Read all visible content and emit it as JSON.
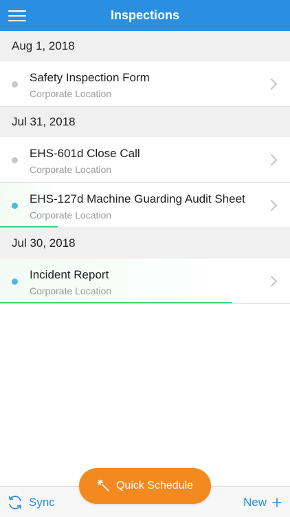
{
  "header": {
    "title": "Inspections"
  },
  "sections": [
    {
      "date": "Aug 1, 2018",
      "items": [
        {
          "title": "Safety Inspection Form",
          "subtitle": "Corporate Location",
          "status_color": "#c8c8c8",
          "progress": 0
        }
      ]
    },
    {
      "date": "Jul 31, 2018",
      "items": [
        {
          "title": "EHS-601d Close Call",
          "subtitle": "Corporate Location",
          "status_color": "#c8c8c8",
          "progress": 0
        },
        {
          "title": "EHS-127d Machine Guarding Audit Sheet",
          "subtitle": "Corporate Location",
          "status_color": "#4fb8e0",
          "progress": 0.2
        }
      ]
    },
    {
      "date": "Jul 30, 2018",
      "items": [
        {
          "title": "Incident Report",
          "subtitle": "Corporate Location",
          "status_color": "#4fb8e0",
          "progress": 0.8
        }
      ]
    }
  ],
  "toolbar": {
    "sync_label": "Sync",
    "new_label": "New",
    "quick_schedule_label": "Quick Schedule"
  },
  "colors": {
    "accent": "#2a8fe0",
    "quick_schedule": "#f28a1f",
    "progress": "#4bd17c"
  }
}
